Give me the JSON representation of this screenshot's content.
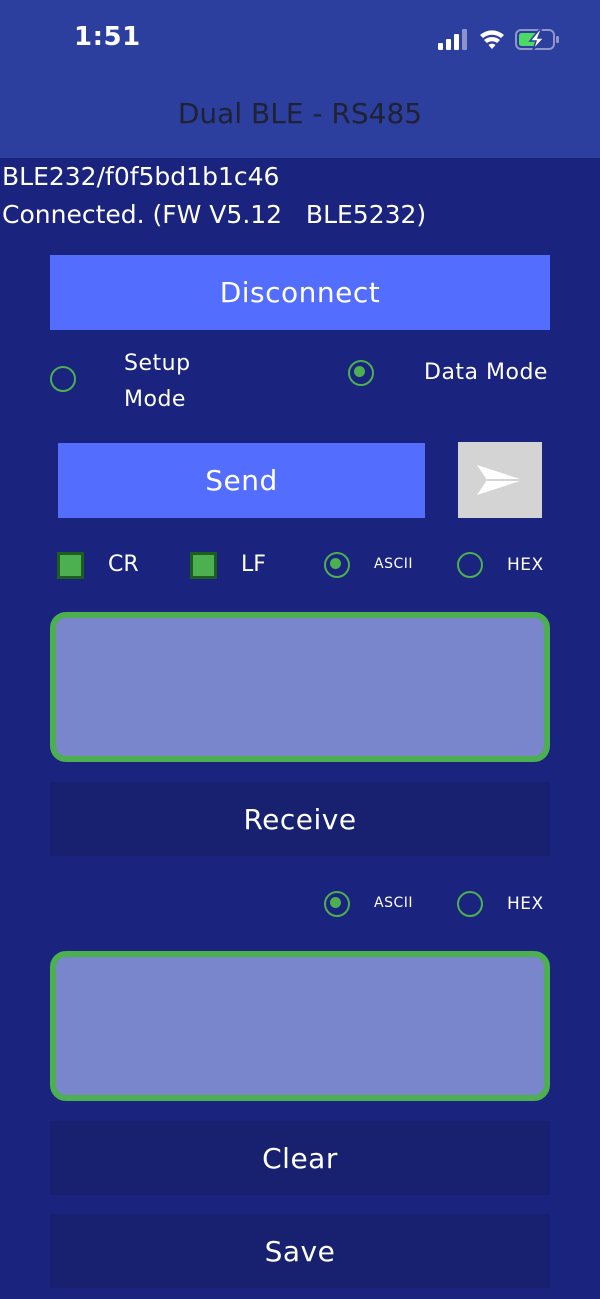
{
  "status_bar": {
    "time": "1:51"
  },
  "header": {
    "title": "Dual BLE - RS485"
  },
  "connection": {
    "device_id": "BLE232/f0f5bd1b1c46",
    "status": "Connected. (FW V5.12   BLE5232)"
  },
  "buttons": {
    "disconnect": "Disconnect",
    "send": "Send",
    "receive": "Receive",
    "clear": "Clear",
    "save": "Save"
  },
  "mode": {
    "setup_line1": "Setup",
    "setup_line2": "Mode",
    "data": "Data Mode",
    "selected": "data"
  },
  "send_options": {
    "cr_label": "CR",
    "cr_checked": true,
    "lf_label": "LF",
    "lf_checked": true,
    "ascii_label": "ASCII",
    "hex_label": "HEX",
    "format_selected": "ascii"
  },
  "receive_options": {
    "ascii_label": "ASCII",
    "hex_label": "HEX",
    "format_selected": "ascii"
  },
  "send_text": "",
  "receive_text": "",
  "colors": {
    "background": "#1a237e",
    "header": "#2c3e9e",
    "primary_button": "#536dfe",
    "dark_button": "#172170",
    "accent_green": "#4caf50",
    "textarea_fill": "#7986cb"
  }
}
